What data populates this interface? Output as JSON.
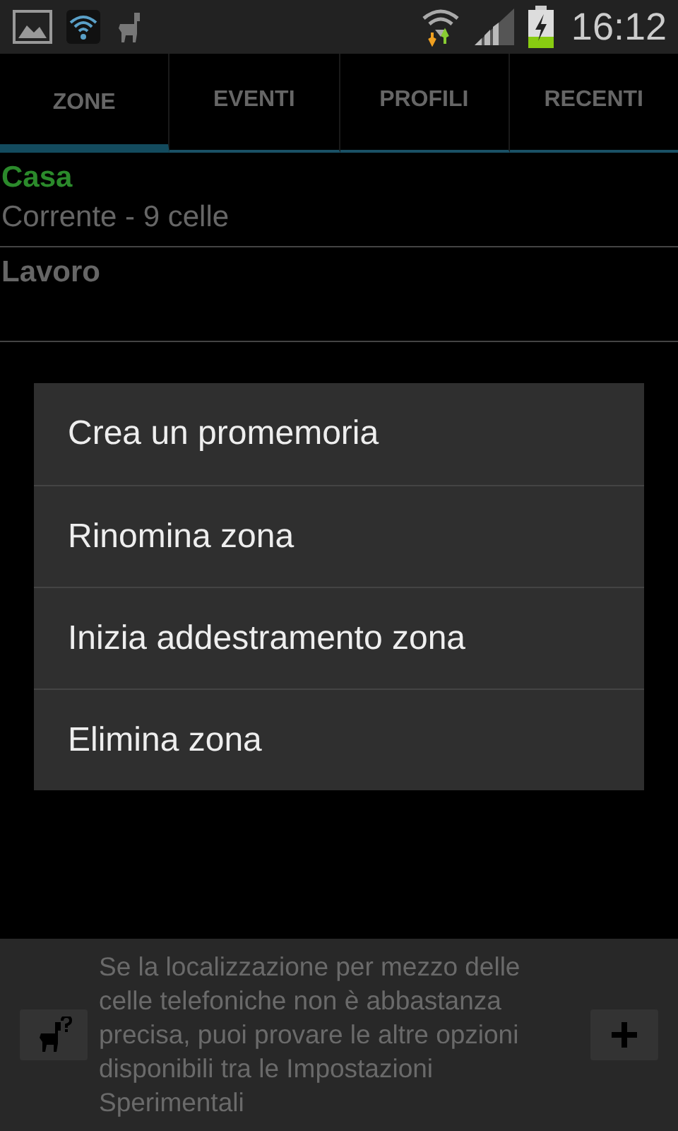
{
  "status_bar": {
    "time": "16:12"
  },
  "tabs": [
    {
      "label": "ZONE",
      "selected": true
    },
    {
      "label": "EVENTI",
      "selected": false
    },
    {
      "label": "PROFILI",
      "selected": false
    },
    {
      "label": "RECENTI",
      "selected": false
    }
  ],
  "zones": [
    {
      "name": "Casa",
      "active": true,
      "detail": "Corrente - 9 celle"
    },
    {
      "name": "Lavoro",
      "active": false
    }
  ],
  "context_menu": {
    "items": [
      "Crea un promemoria",
      "Rinomina zona",
      "Inizia addestramento zona",
      "Elimina zona"
    ]
  },
  "hint_bar": {
    "text": "Se la localizzazione per mezzo delle celle telefoniche non è abbastanza precisa, puoi provare le altre opzioni disponibili tra le Impostazioni Sperimentali"
  }
}
